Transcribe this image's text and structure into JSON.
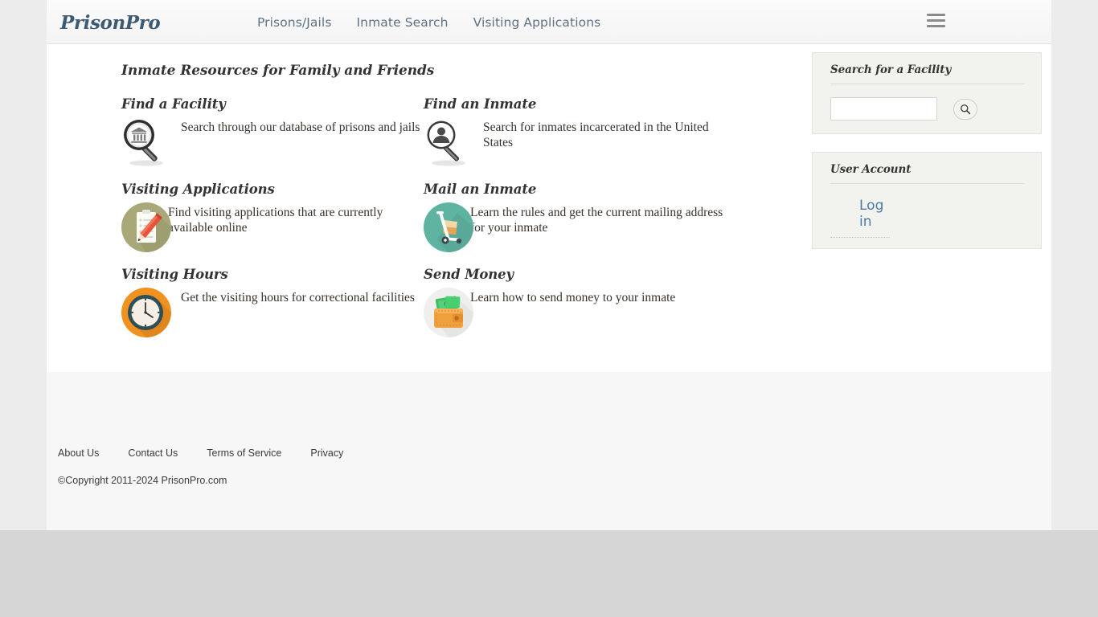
{
  "header": {
    "logo": "PrisonPro",
    "nav": [
      {
        "label": "Prisons/Jails",
        "name": "nav-prisons-jails"
      },
      {
        "label": "Inmate Search",
        "name": "nav-inmate-search"
      },
      {
        "label": "Visiting Applications",
        "name": "nav-visiting-applications"
      }
    ],
    "menu_icon": "hamburger-menu-icon"
  },
  "main": {
    "page_title": "Inmate Resources for Family and Friends",
    "resources": [
      {
        "title": "Find a Facility",
        "description": "Search through our database of prisons and jails",
        "icon": "magnifier-bank-icon"
      },
      {
        "title": "Find an Inmate",
        "description": "Search for inmates incarcerated in the United States",
        "icon": "magnifier-person-icon"
      },
      {
        "title": "Visiting Applications",
        "description": "Find visiting applications that are currently available online",
        "icon": "clipboard-pencil-icon"
      },
      {
        "title": "Mail an Inmate",
        "description": "Learn the rules and get the current mailing address for your inmate",
        "icon": "hand-truck-boxes-icon"
      },
      {
        "title": "Visiting Hours",
        "description": "Get the visiting hours for correctional facilities",
        "icon": "clock-icon"
      },
      {
        "title": "Send Money",
        "description": "Learn how to send money to your inmate",
        "icon": "wallet-money-icon"
      }
    ]
  },
  "sidebar": {
    "facility_search": {
      "title": "Search for a Facility",
      "input_value": "",
      "input_placeholder": "",
      "button_icon": "search-icon"
    },
    "user_account": {
      "title": "User Account",
      "links": [
        {
          "label": "Log in",
          "name": "log-in-link"
        }
      ]
    }
  },
  "footer": {
    "links": [
      {
        "label": "About Us",
        "name": "footer-link-about-us"
      },
      {
        "label": "Contact Us",
        "name": "footer-link-contact-us"
      },
      {
        "label": "Terms of Service",
        "name": "footer-link-terms-of-service"
      },
      {
        "label": "Privacy",
        "name": "footer-link-privacy"
      }
    ],
    "copyright": "©Copyright 2011-2024 PrisonPro.com"
  },
  "colors": {
    "logo": "#3d5a73",
    "nav_text": "#5f7184",
    "link_blue": "#4a7ba5",
    "panel_bg": "#f2f2ef",
    "icon_olive": "#a9a878",
    "icon_teal": "#5fb3a1",
    "icon_orange": "#f19120",
    "icon_money_green": "#3fbf62"
  }
}
